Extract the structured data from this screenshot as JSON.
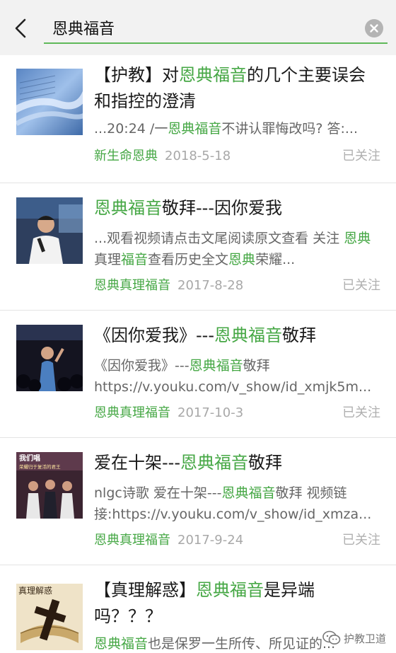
{
  "search": {
    "query": "恩典福音"
  },
  "results": [
    {
      "title_parts": [
        "【护教】对",
        "恩典福音",
        "的几个主要误会和指控的澄清"
      ],
      "snippet_parts": [
        "...20:24 /一",
        "恩典福音",
        "不讲认罪悔改吗? 答:..."
      ],
      "source": "新生命恩典",
      "date": "2018-5-18",
      "follow": "已关注",
      "thumb_icon": "bible-pages-icon"
    },
    {
      "title_parts": [
        "恩典福音",
        "敬拜---因你爱我"
      ],
      "snippet_parts": [
        "...观看视频请点击文尾阅读原文查看 关注 ",
        "恩典",
        "真理",
        "福音",
        "查看历史全文",
        "恩典",
        "荣耀..."
      ],
      "source": "恩典真理福音",
      "date": "2017-8-28",
      "follow": "已关注",
      "thumb_icon": "singer-stage-icon"
    },
    {
      "title_parts": [
        "《因你爱我》---",
        "恩典福音",
        "敬拜"
      ],
      "snippet_parts": [
        "《因你爱我》---",
        "恩典福音",
        "敬拜 https://v.youku.com/v_show/id_xmjk5m..."
      ],
      "source": "恩典真理福音",
      "date": "2017-10-3",
      "follow": "已关注",
      "thumb_icon": "concert-crowd-icon"
    },
    {
      "title_parts": [
        "爱在十架---",
        "恩典福音",
        "敬拜"
      ],
      "snippet_parts": [
        "nlgc诗歌 爱在十架---",
        "恩典福音",
        "敬拜 视频链接:https://v.youku.com/v_show/id_xmza..."
      ],
      "source": "恩典真理福音",
      "date": "2017-9-24",
      "follow": "已关注",
      "thumb_icon": "worship-team-icon",
      "thumb_text_1": "我们唱",
      "thumb_text_2": "荣耀归于复活的君王"
    },
    {
      "title_parts": [
        "【真理解惑】",
        "恩典福音",
        "是异端吗？？？"
      ],
      "snippet_parts": [
        "恩典福音",
        "也是保罗一生所传、所见证的..."
      ],
      "thumb_icon": "cross-bible-icon",
      "thumb_text": "真理解惑"
    }
  ],
  "watermark": {
    "text": "护教卫道",
    "icon": "wechat-icon"
  }
}
